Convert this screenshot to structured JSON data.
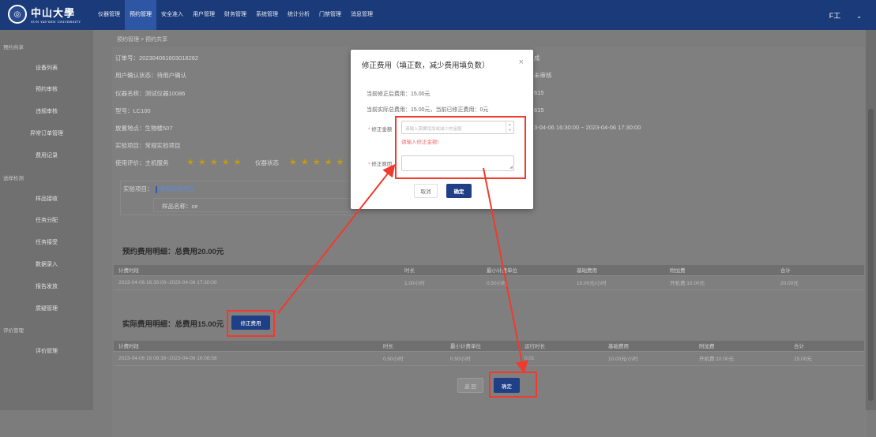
{
  "header": {
    "logo_cn": "中山大學",
    "logo_en": "SUN YAT-SEN UNIVERSITY",
    "nav": [
      "仪器管理",
      "预约管理",
      "安全准入",
      "用户管理",
      "财务管理",
      "系统管理",
      "统计分析",
      "门禁管理",
      "消息管理"
    ],
    "active_nav": "预约管理",
    "user": "F工",
    "user_chevron": "⌄"
  },
  "sidebar": {
    "groups": [
      "预约共享",
      "送样检测",
      "评价管理"
    ],
    "items_share": [
      "设备列表",
      "预约审核",
      "违规审核",
      "异常订单管理",
      "费用记录"
    ],
    "items_test": [
      "样品接收",
      "任务分配",
      "任务接受",
      "数据录入",
      "报告发放",
      "质疑管理"
    ],
    "items_eval": [
      "评价管理"
    ]
  },
  "breadcrumb": "预约管理 > 预约共享",
  "order": {
    "order_no": "订单号：2023040616030182​62",
    "confirm_status": "用户确认状态：待用户确认",
    "instrument": "仪器名称：测试仪器10086",
    "model": "型号：LC100",
    "location": "放置地点：生物楼507",
    "project": "实验项目：常规实验项目",
    "rating_label": "使用评价：主机服务",
    "rating_label2": "仪器状态",
    "stars": "★ ★ ★ ★ ★",
    "right_1": "成",
    "right_2": "未审核",
    "right_3": "615",
    "right_4": "615",
    "right_time": "3-04-06 16:30:00 ~ 2023-04-06 17:30:00"
  },
  "experiment": {
    "label": "实验项目：",
    "link": "常规实验项目",
    "sample": "样品名称：ce"
  },
  "booking": {
    "title": "预约费用明细：总费用20.00元",
    "headers": [
      "计费时段",
      "时长",
      "最小计费单位",
      "基础费用",
      "附加费",
      "合计"
    ],
    "rows": [
      [
        "2023-04-06 16:30:00~2023-04-06 17:30:00",
        "1.00小时",
        "0.50小时",
        "10.00元/小时",
        "开机费:10.00元",
        "20.00元"
      ]
    ]
  },
  "actual": {
    "title": "实际费用明细：总费用15.00元",
    "fix_button": "修正费用",
    "headers": [
      "计费时段",
      "时长",
      "最小计费单位",
      "运行时长",
      "基础费用",
      "附加费",
      "合计"
    ],
    "rows": [
      [
        "2023-04-06 16:08:36~2023-04-06 16:08:58",
        "0.50小时",
        "0.50小时",
        "0.01",
        "10.00元/小时",
        "开机费:10.00元",
        "15.00元"
      ]
    ]
  },
  "footer": {
    "back_button": "返 回",
    "confirm_button": "确定"
  },
  "modal": {
    "title": "修正费用（填正数，减少费用填负数）",
    "close": "×",
    "line1": "当前修正后费用：15.00元",
    "line2": "当前实际总费用：15.00元，当前已修正费用：0元",
    "req_mark": "*",
    "amount_label": "修正金额",
    "amount_placeholder": "请输入需要增加或减少的金额",
    "spin_up": "▲",
    "spin_down": "▼",
    "amount_error": "请输入修正金额!",
    "reason_label": "修正原因",
    "resize_glyph": "◢",
    "cancel": "取消",
    "ok": "确定"
  }
}
